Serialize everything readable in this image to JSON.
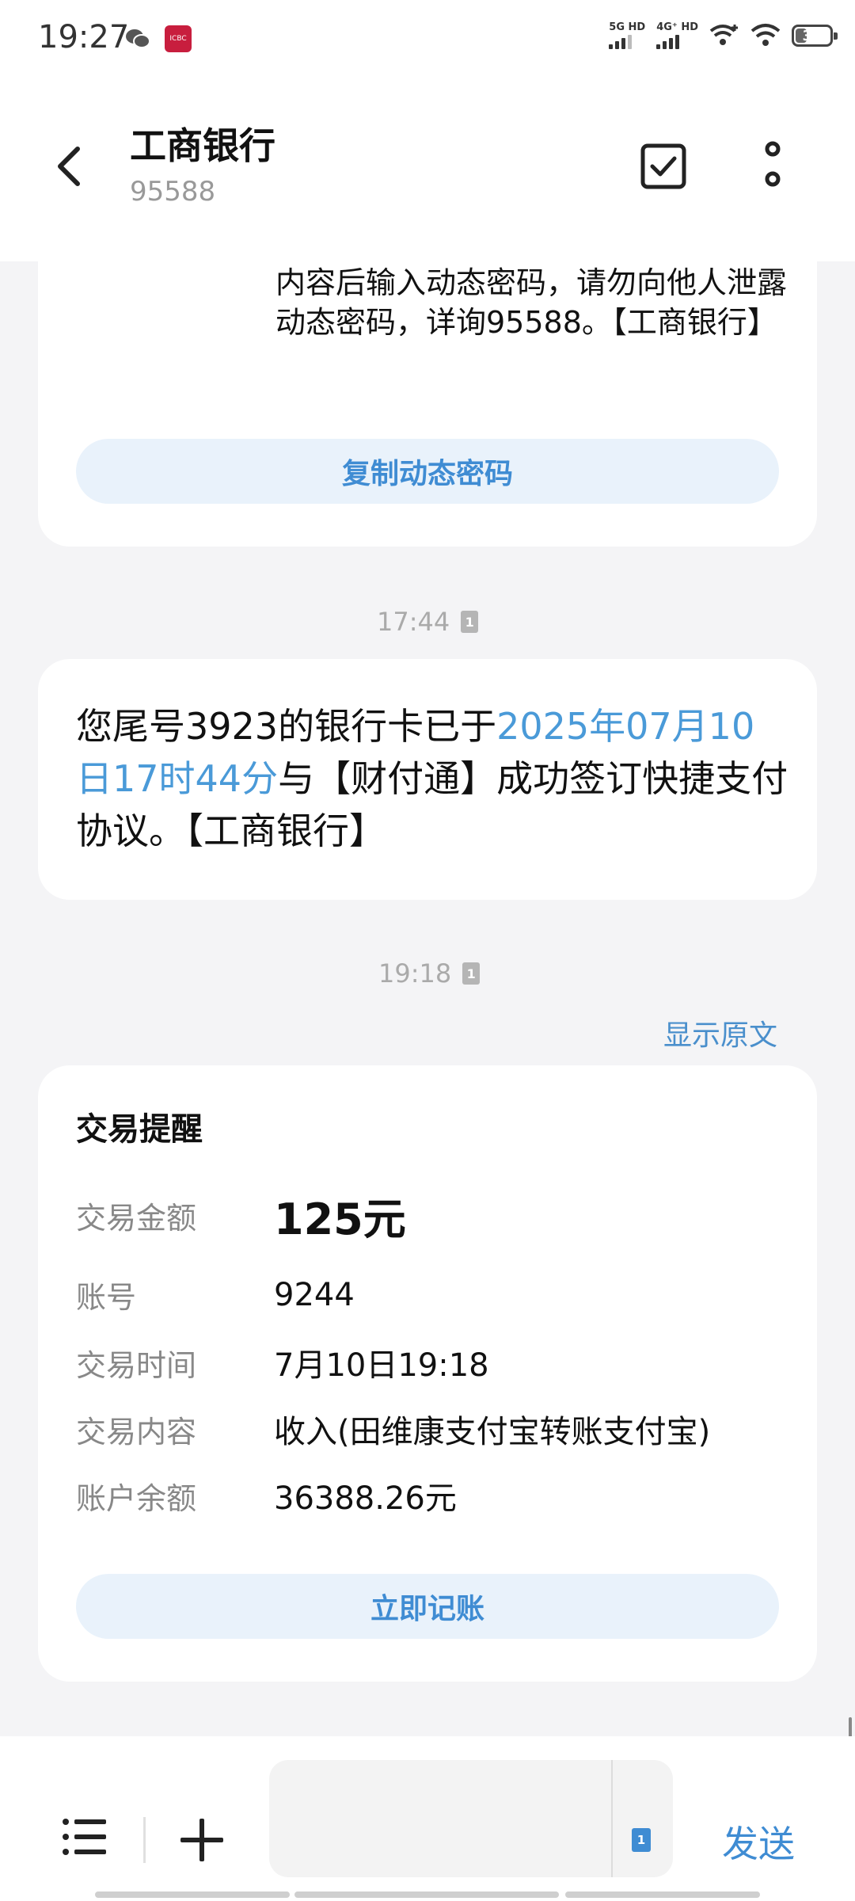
{
  "status_bar": {
    "time": "19:27",
    "app_badge": "ICBC",
    "signal1_label": "5G HD",
    "signal2_label": "4G⁺ HD",
    "battery": "31"
  },
  "header": {
    "title": "工商银行",
    "number": "95588"
  },
  "messages": [
    {
      "text": "内容后输入动态密码，请勿向他人泄露动态密码，详询95588。【工商银行】",
      "button": "复制动态密码"
    },
    {
      "time": "17:44",
      "sim": "1",
      "text_parts": [
        "您尾号3923的银行卡已于",
        "2025年07月10日17时44分",
        "与【财付通】成功签订快捷支付协议。【工商银行】"
      ]
    },
    {
      "time": "19:18",
      "sim": "1",
      "show_original": "显示原文",
      "card_title": "交易提醒",
      "rows": [
        {
          "label": "交易金额",
          "value": "125元"
        },
        {
          "label": "账号",
          "value": "9244"
        },
        {
          "label": "交易时间",
          "value": "7月10日19:18"
        },
        {
          "label": "交易内容",
          "value": "收入(田维康支付宝转账支付宝)"
        },
        {
          "label": "账户余额",
          "value": "36388.26元"
        }
      ],
      "button": "立即记账"
    }
  ],
  "compose": {
    "placeholder": "",
    "sim": "1",
    "send_label": "发送"
  },
  "colors": {
    "accent": "#3f8cd3",
    "highlight": "#4a9ad8",
    "background": "#f4f4f6"
  }
}
